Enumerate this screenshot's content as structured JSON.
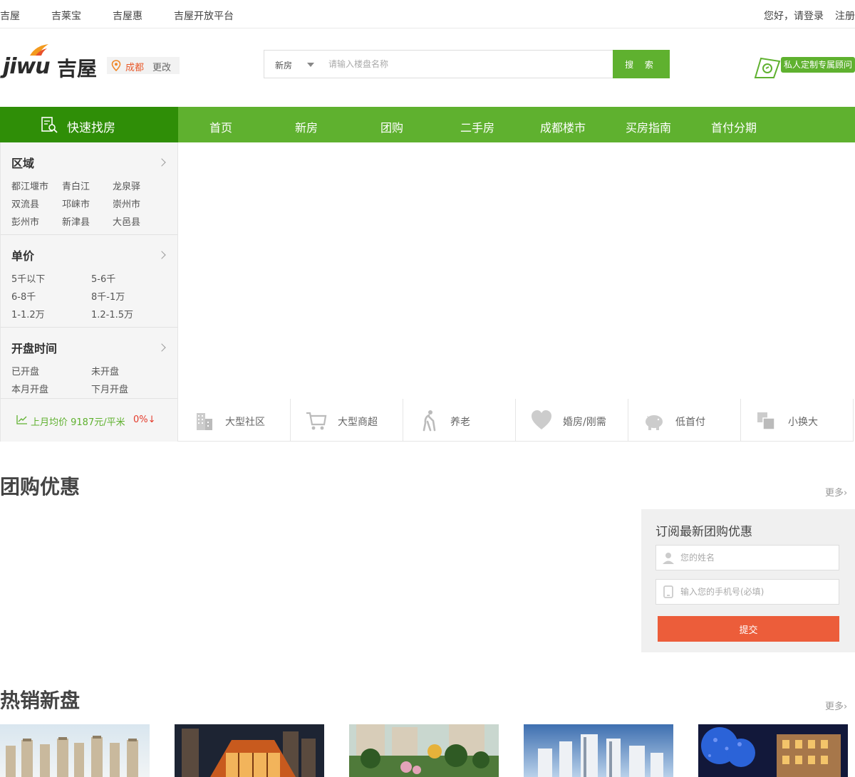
{
  "topbar": {
    "links": [
      "吉屋",
      "吉莱宝",
      "吉屋惠",
      "吉屋开放平台"
    ],
    "login": "您好，请登录",
    "register": "注册"
  },
  "header": {
    "logo_latin": "jiwu",
    "logo_cn": "吉屋",
    "city": "成都",
    "city_change": "更改",
    "search_type": "新房",
    "search_placeholder": "请输入楼盘名称",
    "search_button": "搜 索",
    "advisor_label": "私人定制专属顾问"
  },
  "nav": {
    "quick_label": "快速找房",
    "items": [
      "首页",
      "新房",
      "团购",
      "二手房",
      "成都楼市",
      "买房指南",
      "首付分期"
    ]
  },
  "sidebar": {
    "region": {
      "title": "区域",
      "options": [
        "都江堰市",
        "青白江",
        "龙泉驿",
        "双流县",
        "邛崃市",
        "崇州市",
        "彭州市",
        "新津县",
        "大邑县"
      ]
    },
    "price": {
      "title": "单价",
      "options": [
        "5千以下",
        "5-6千",
        "6-8千",
        "8千-1万",
        "1-1.2万",
        "1.2-1.5万"
      ]
    },
    "opening": {
      "title": "开盘时间",
      "options": [
        "已开盘",
        "未开盘",
        "本月开盘",
        "下月开盘"
      ]
    },
    "trend_text": "上月均价 9187元/平米",
    "trend_pct": "0%↓"
  },
  "features": [
    {
      "label": "大型社区",
      "icon": "buildings-icon"
    },
    {
      "label": "大型商超",
      "icon": "shopping-cart-icon"
    },
    {
      "label": "养老",
      "icon": "elderly-icon"
    },
    {
      "label": "婚房/刚需",
      "icon": "heart-icon"
    },
    {
      "label": "低首付",
      "icon": "piggy-bank-icon"
    },
    {
      "label": "小换大",
      "icon": "resize-icon"
    }
  ],
  "group_buy": {
    "heading": "团购优惠",
    "more": "更多",
    "subscribe_title": "订阅最新团购优惠",
    "name_placeholder": "您的姓名",
    "phone_placeholder": "输入您的手机号(必填)",
    "submit": "提交"
  },
  "hot": {
    "heading": "热销新盘",
    "more": "更多"
  },
  "colors": {
    "brand_green": "#5fb12f",
    "dark_green": "#2f8e07",
    "accent_orange": "#ec5d3a"
  }
}
